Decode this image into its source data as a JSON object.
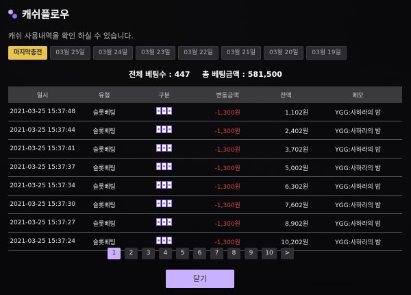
{
  "header": {
    "title": "캐쉬플로우",
    "subtitle": "캐쉬 사용내역을 확인 하실 수 있습니다."
  },
  "date_tabs": [
    "마지막충전",
    "03월 25일",
    "03월 24일",
    "03월 23일",
    "03월 22일",
    "03월 21일",
    "03월 20일",
    "03월 19일"
  ],
  "summary": {
    "total_bets_label": "전체 베팅수 :",
    "total_bets_value": "447",
    "total_amount_label": "총 베팅금액 :",
    "total_amount_value": "581,500"
  },
  "table": {
    "columns": [
      "일시",
      "유형",
      "구분",
      "변동금액",
      "잔액",
      "메모"
    ],
    "rows": [
      {
        "datetime": "2021-03-25 15:37:48",
        "type": "슬롯베팅",
        "icon": "slot-machine-icon",
        "change": "-1,300원",
        "balance": "1,102원",
        "memo": "YGG:사하라의 밤"
      },
      {
        "datetime": "2021-03-25 15:37:44",
        "type": "슬롯베팅",
        "icon": "slot-machine-icon",
        "change": "-1,300원",
        "balance": "2,402원",
        "memo": "YGG:사하라의 밤"
      },
      {
        "datetime": "2021-03-25 15:37:41",
        "type": "슬롯베팅",
        "icon": "slot-machine-icon",
        "change": "-1,300원",
        "balance": "3,702원",
        "memo": "YGG:사하라의 밤"
      },
      {
        "datetime": "2021-03-25 15:37:37",
        "type": "슬롯베팅",
        "icon": "slot-machine-icon",
        "change": "-1,300원",
        "balance": "5,002원",
        "memo": "YGG:사하라의 밤"
      },
      {
        "datetime": "2021-03-25 15:37:34",
        "type": "슬롯베팅",
        "icon": "slot-machine-icon",
        "change": "-1,300원",
        "balance": "6,302원",
        "memo": "YGG:사하라의 밤"
      },
      {
        "datetime": "2021-03-25 15:37:30",
        "type": "슬롯베팅",
        "icon": "slot-machine-icon",
        "change": "-1,300원",
        "balance": "7,602원",
        "memo": "YGG:사하라의 밤"
      },
      {
        "datetime": "2021-03-25 15:37:27",
        "type": "슬롯베팅",
        "icon": "slot-machine-icon",
        "change": "-1,300원",
        "balance": "8,902원",
        "memo": "YGG:사하라의 밤"
      },
      {
        "datetime": "2021-03-25 15:37:24",
        "type": "슬롯베팅",
        "icon": "slot-machine-icon",
        "change": "-1,300원",
        "balance": "10,202원",
        "memo": "YGG:사하라의 밤"
      }
    ]
  },
  "pagination": {
    "pages": [
      "1",
      "2",
      "3",
      "4",
      "5",
      "6",
      "7",
      "8",
      "9",
      "10"
    ],
    "next_label": ">",
    "current": "1"
  },
  "close_button": "닫기",
  "colors": {
    "accent": "#c8b2ff",
    "active_tab": "#e7c44e",
    "negative": "#e04848"
  }
}
